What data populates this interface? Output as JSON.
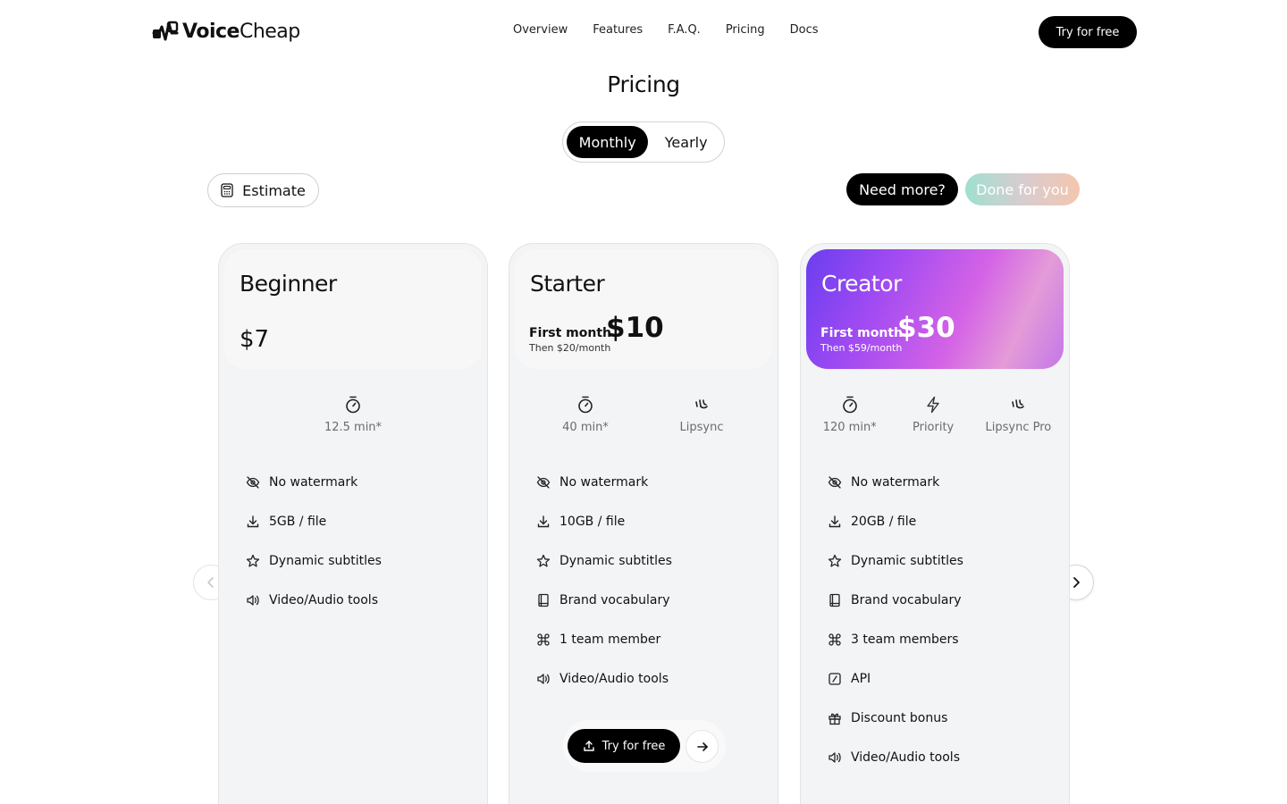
{
  "nav": {
    "brand_bold": "Voice",
    "brand_light": "Cheap",
    "links": [
      "Overview",
      "Features",
      "F.A.Q.",
      "Pricing",
      "Docs"
    ],
    "cta_label": "Try for free"
  },
  "page": {
    "title": "Pricing",
    "toggle": {
      "monthly": "Monthly",
      "yearly": "Yearly",
      "selected": "Monthly"
    },
    "estimate_label": "Estimate",
    "need_more_label": "Need more?",
    "done_for_you_label": "Done for you"
  },
  "plans": [
    {
      "name": "Beginner",
      "price": "$7",
      "stats": [
        {
          "icon": "timer-icon",
          "label": "12.5 min*"
        }
      ],
      "features": [
        {
          "icon": "eye-off-icon",
          "label": "No watermark"
        },
        {
          "icon": "download-icon",
          "label": "5GB / file"
        },
        {
          "icon": "star-icon",
          "label": "Dynamic subtitles"
        },
        {
          "icon": "speaker-icon",
          "label": "Video/Audio tools"
        }
      ]
    },
    {
      "name": "Starter",
      "first_month_label": "First month",
      "price": "$10",
      "then": "Then $20/month",
      "stats": [
        {
          "icon": "timer-icon",
          "label": "40 min*"
        },
        {
          "icon": "lipsync-icon",
          "label": "Lipsync"
        }
      ],
      "features": [
        {
          "icon": "eye-off-icon",
          "label": "No watermark"
        },
        {
          "icon": "download-icon",
          "label": "10GB / file"
        },
        {
          "icon": "star-icon",
          "label": "Dynamic subtitles"
        },
        {
          "icon": "book-icon",
          "label": "Brand vocabulary"
        },
        {
          "icon": "command-icon",
          "label": "1 team member"
        },
        {
          "icon": "speaker-icon",
          "label": "Video/Audio tools"
        }
      ],
      "cta_label": "Try for free"
    },
    {
      "name": "Creator",
      "first_month_label": "First month",
      "price": "$30",
      "then": "Then $59/month",
      "stats": [
        {
          "icon": "timer-icon",
          "label": "120 min*"
        },
        {
          "icon": "bolt-icon",
          "label": "Priority"
        },
        {
          "icon": "lipsync-icon",
          "label": "Lipsync Pro"
        }
      ],
      "features": [
        {
          "icon": "eye-off-icon",
          "label": "No watermark"
        },
        {
          "icon": "download-icon",
          "label": "20GB / file"
        },
        {
          "icon": "star-icon",
          "label": "Dynamic subtitles"
        },
        {
          "icon": "book-icon",
          "label": "Brand vocabulary"
        },
        {
          "icon": "command-icon",
          "label": "3 team members"
        },
        {
          "icon": "api-icon",
          "label": "API"
        },
        {
          "icon": "gift-icon",
          "label": "Discount bonus"
        },
        {
          "icon": "speaker-icon",
          "label": "Video/Audio tools"
        }
      ]
    }
  ],
  "colors": {
    "primary": "#000000",
    "card_bg": "#f3f4f6",
    "creator_gradient": [
      "#6a3ef0",
      "#d463e6"
    ],
    "done_for_you_gradient": [
      "#9fe0cf",
      "#f4c6ae"
    ]
  }
}
